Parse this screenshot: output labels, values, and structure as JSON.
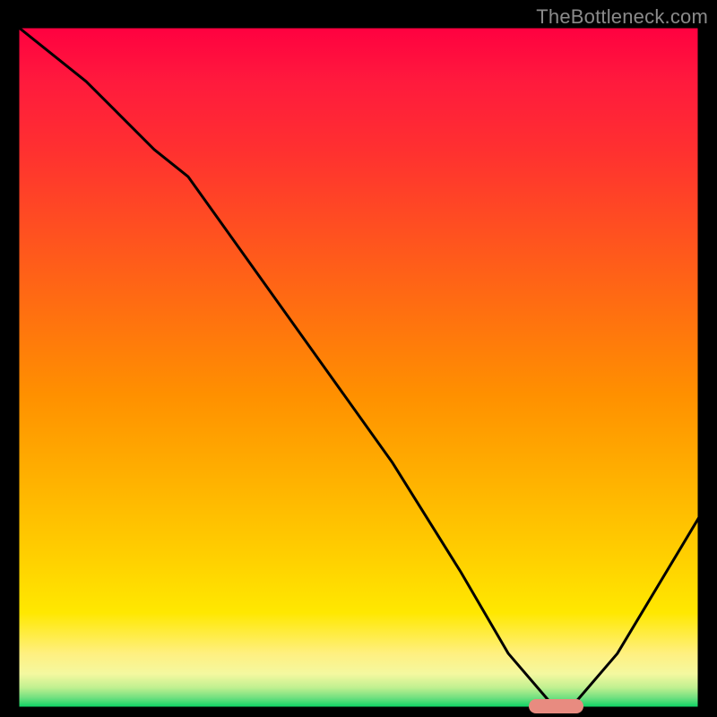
{
  "watermark": "TheBottleneck.com",
  "chart_data": {
    "type": "line",
    "x": [
      0,
      0.1,
      0.2,
      0.25,
      0.35,
      0.45,
      0.55,
      0.65,
      0.72,
      0.78,
      0.82,
      0.88,
      1.0
    ],
    "values": [
      100,
      92,
      82,
      78,
      64,
      50,
      36,
      20,
      8,
      1,
      1,
      8,
      28
    ],
    "title": "",
    "xlabel": "",
    "ylabel": "",
    "xlim": [
      0,
      1
    ],
    "ylim": [
      0,
      100
    ],
    "marker": {
      "x_start": 0.75,
      "x_end": 0.83,
      "y": 0
    },
    "colors": {
      "top": "#ff0040",
      "mid_high": "#ff7010",
      "mid": "#ffd000",
      "low": "#fff080",
      "bottom": "#00d060",
      "line": "#000000",
      "marker": "#e88b80"
    }
  }
}
